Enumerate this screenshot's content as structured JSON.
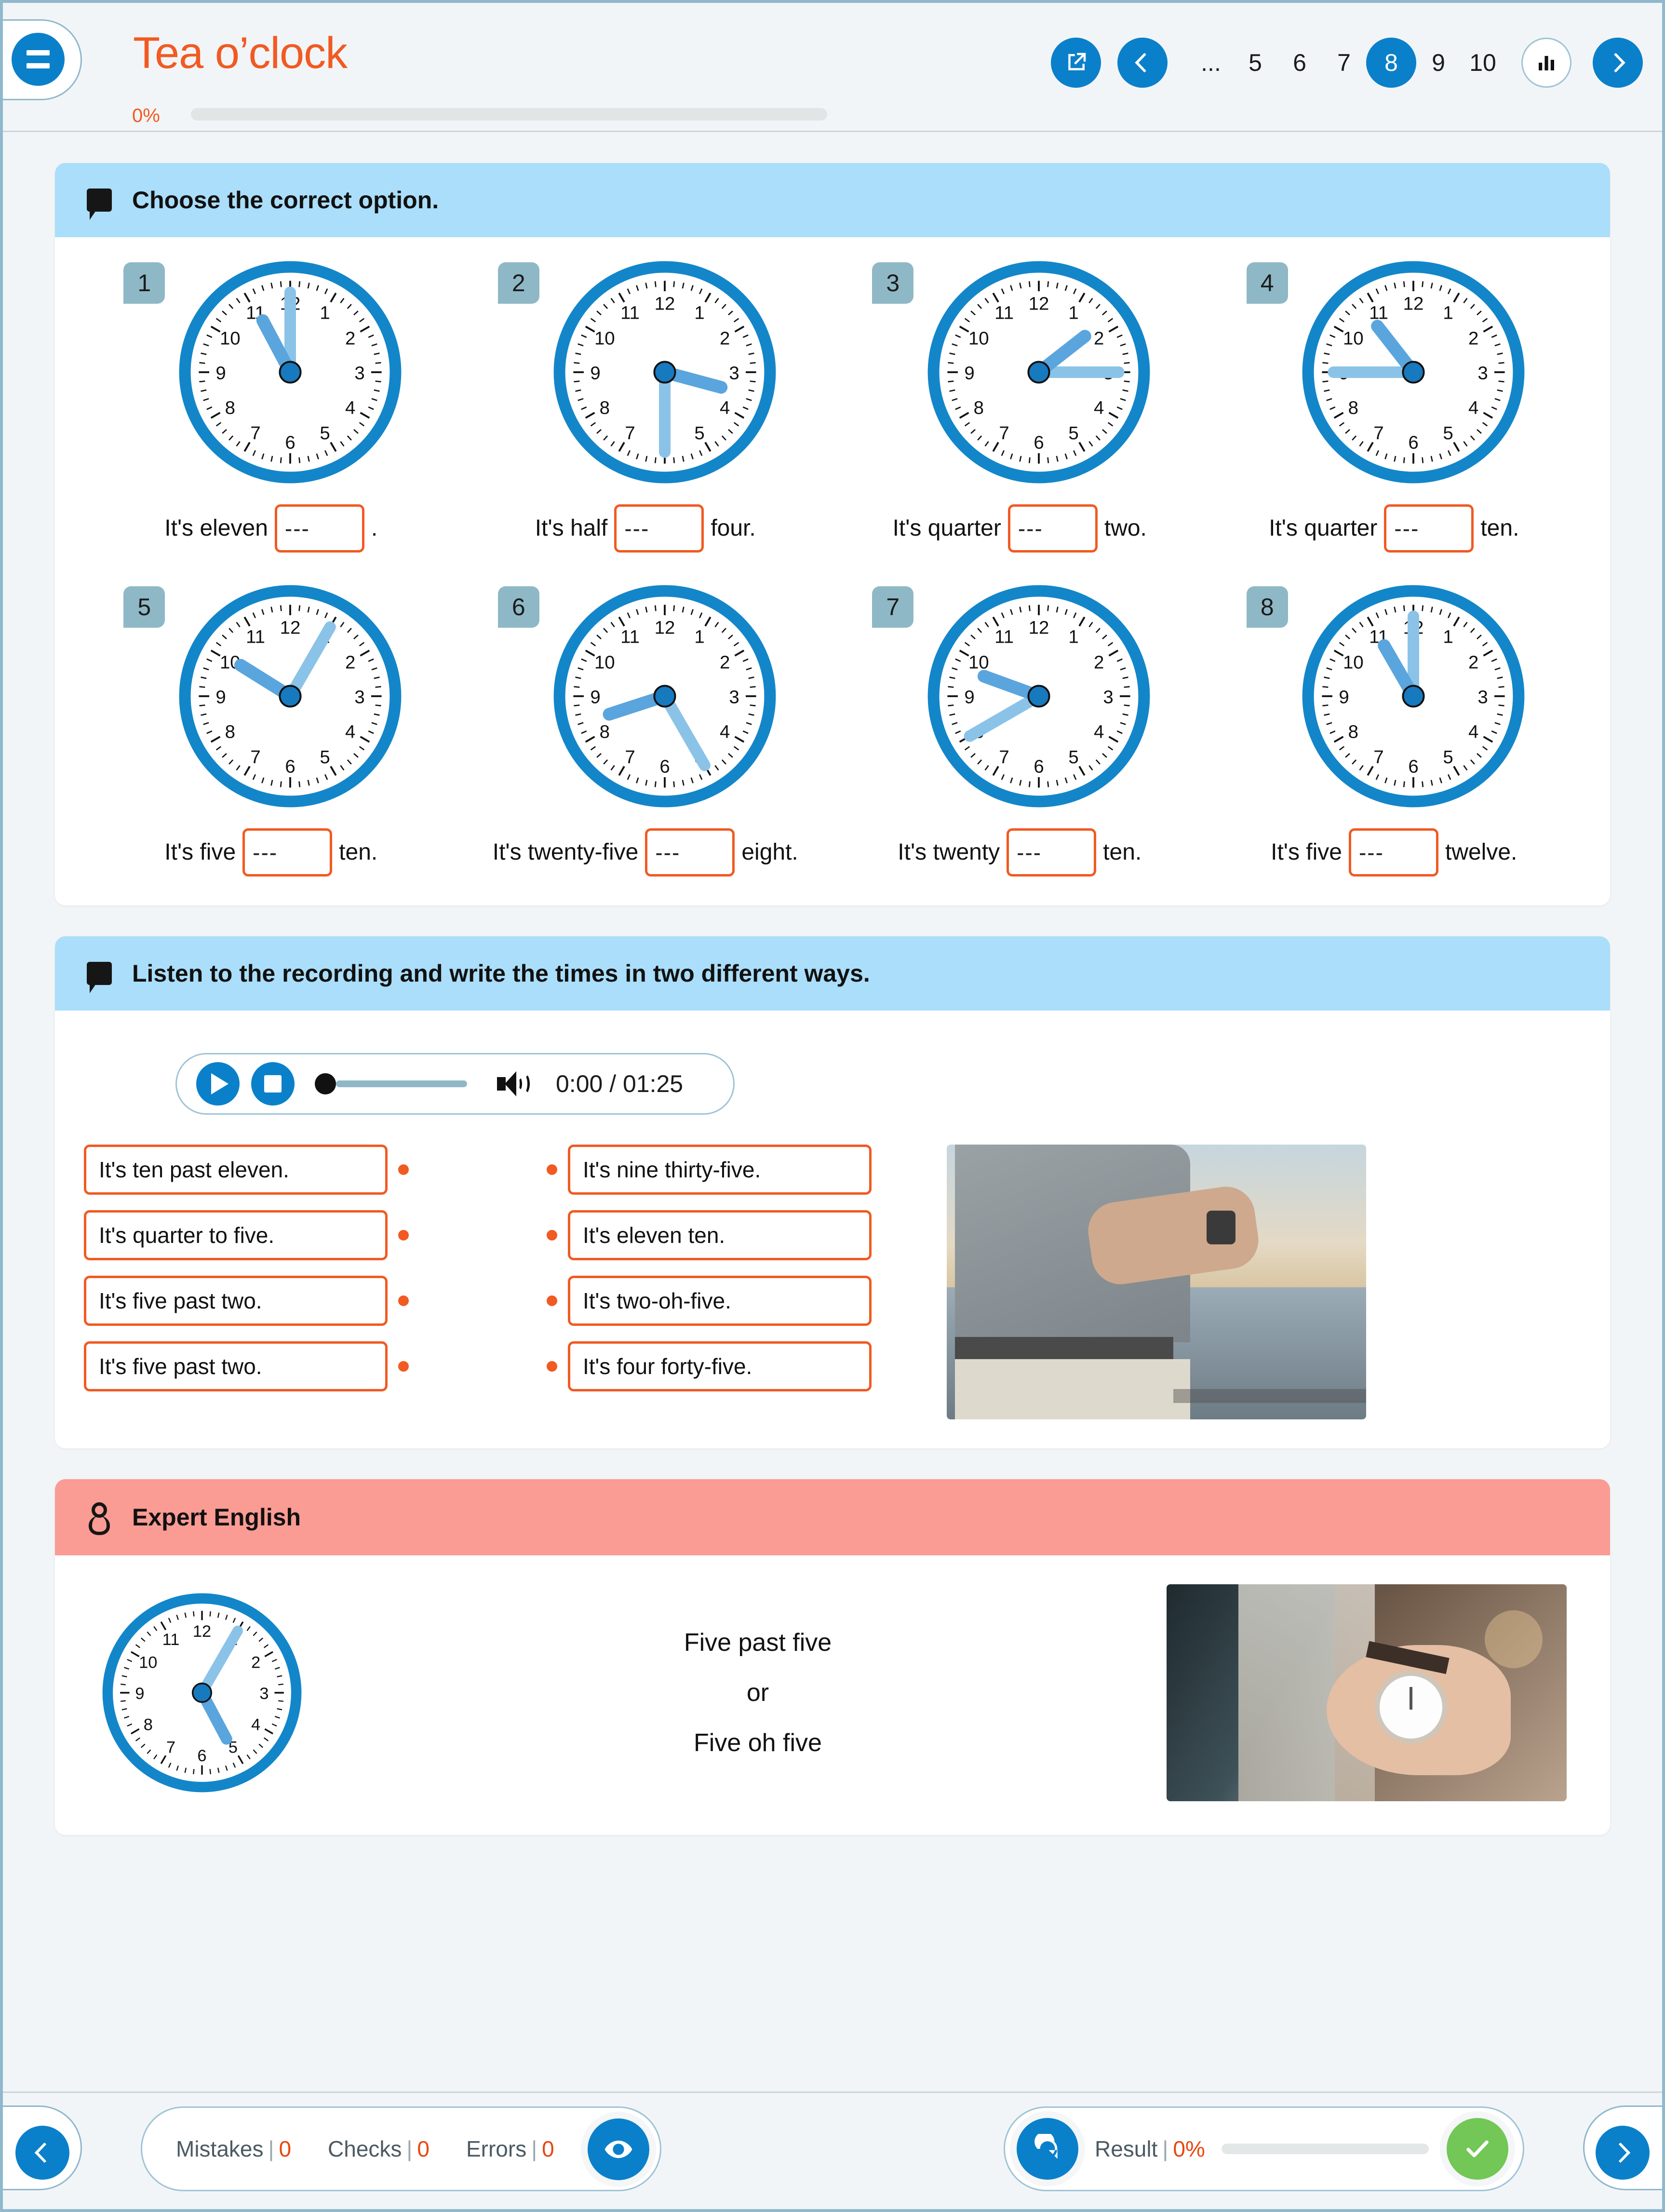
{
  "header": {
    "title": "Tea o’clock",
    "progress_percent": "0%",
    "progress_value": 0,
    "menu_icon": "hamburger-icon",
    "external_icon": "open-external-icon",
    "prev_icon": "chevron-left-icon",
    "next_icon": "chevron-right-icon",
    "stats_icon": "bar-chart-icon",
    "pages": [
      "...",
      "5",
      "6",
      "7",
      "8",
      "9",
      "10"
    ],
    "active_page": "8"
  },
  "exercise1": {
    "icon": "speech-bubble-icon",
    "instruction": "Choose the correct option.",
    "items": [
      {
        "n": "1",
        "pre": "It's eleven",
        "blank": "---",
        "post": ".",
        "hour_deg": 332,
        "minute_deg": 0
      },
      {
        "n": "2",
        "pre": "It's half",
        "blank": "---",
        "post": "four.",
        "hour_deg": 105,
        "minute_deg": 180
      },
      {
        "n": "3",
        "pre": "It's quarter",
        "blank": "---",
        "post": "two.",
        "hour_deg": 52,
        "minute_deg": 90
      },
      {
        "n": "4",
        "pre": "It's quarter",
        "blank": "---",
        "post": "ten.",
        "hour_deg": 322,
        "minute_deg": 270
      },
      {
        "n": "5",
        "pre": "It's five",
        "blank": "---",
        "post": "ten.",
        "hour_deg": 302,
        "minute_deg": 30
      },
      {
        "n": "6",
        "pre": "It's twenty-five",
        "blank": "---",
        "post": "eight.",
        "hour_deg": 252,
        "minute_deg": 150
      },
      {
        "n": "7",
        "pre": "It's twenty",
        "blank": "---",
        "post": "ten.",
        "hour_deg": 290,
        "minute_deg": 240
      },
      {
        "n": "8",
        "pre": "It's five",
        "blank": "---",
        "post": "twelve.",
        "hour_deg": 330,
        "minute_deg": 0
      }
    ]
  },
  "exercise2": {
    "icon": "speech-bubble-icon",
    "instruction": "Listen to the recording and write the times in two different ways.",
    "player": {
      "play_icon": "play-icon",
      "stop_icon": "stop-icon",
      "volume_icon": "volume-icon",
      "time": "0:00 / 01:25",
      "seek_value": 0
    },
    "left_options": [
      "It's ten past eleven.",
      "It's quarter to five.",
      "It's five past two.",
      "It's five past two."
    ],
    "right_options": [
      "It's nine thirty-five.",
      "It's eleven ten.",
      "It's two-oh-five.",
      "It's four forty-five."
    ],
    "image_alt": "man-checking-wristwatch-photo"
  },
  "expert": {
    "icon": "person-icon",
    "title": "Expert English",
    "lines": [
      "Five past five",
      "or",
      "Five oh five"
    ],
    "clock": {
      "hour_deg": 152,
      "minute_deg": 30
    },
    "image_alt": "woman-wearing-white-wristwatch-photo"
  },
  "footer": {
    "prev_icon": "chevron-left-icon",
    "next_icon": "chevron-right-icon",
    "eye_icon": "eye-icon",
    "refresh_icon": "refresh-icon",
    "check_icon": "check-icon",
    "mistakes_label": "Mistakes",
    "mistakes_value": "0",
    "checks_label": "Checks",
    "checks_value": "0",
    "errors_label": "Errors",
    "errors_value": "0",
    "result_label": "Result",
    "result_value": "0%",
    "result_progress": 0
  },
  "colors": {
    "accent_orange": "#f15a22",
    "accent_blue": "#0b80ca",
    "header_blue": "#aadefa",
    "header_red": "#fa9b94",
    "green": "#72c756",
    "clock_rim": "#1386c9",
    "clock_hand": "#62a9de"
  }
}
